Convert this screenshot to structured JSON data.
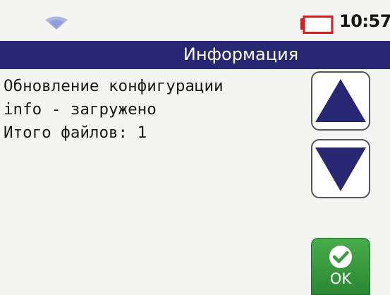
{
  "status": {
    "time": "10:57",
    "signal_icon": "wifi-icon",
    "battery_icon": "battery-icon"
  },
  "header": {
    "title": "Информация"
  },
  "message": {
    "lines": [
      "Обновление конфигурации",
      "info - загружено",
      "Итого файлов: 1"
    ]
  },
  "buttons": {
    "scroll_up_icon": "arrow-up-icon",
    "scroll_down_icon": "arrow-down-icon",
    "ok_label": "OK",
    "ok_icon": "checkmark-icon"
  },
  "colors": {
    "titlebar": "#272773",
    "arrow": "#272773",
    "ok_button": "#3a9b3f",
    "battery": "#d42020"
  }
}
